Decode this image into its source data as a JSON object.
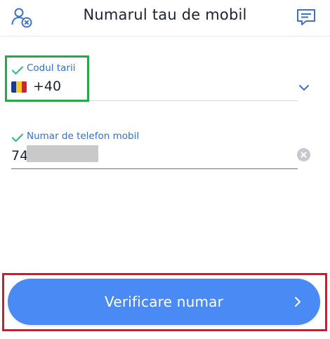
{
  "header": {
    "title": "Numarul tau de mobil",
    "left_icon": "user-x-icon",
    "right_icon": "chat-icon"
  },
  "country_field": {
    "label": "Codul tarii",
    "flag": "romania-flag",
    "flag_colors": [
      "#1b3a8c",
      "#f7c928",
      "#d6202c"
    ],
    "value": "+40"
  },
  "phone_field": {
    "label": "Numar de telefon mobil",
    "value": "74"
  },
  "verify_button": {
    "label": "Verificare numar"
  },
  "colors": {
    "accent": "#2f6ed6",
    "check": "#2ebf8f",
    "button": "#4a8af5",
    "highlight_green": "#25a74a",
    "highlight_red": "#d7182a"
  }
}
